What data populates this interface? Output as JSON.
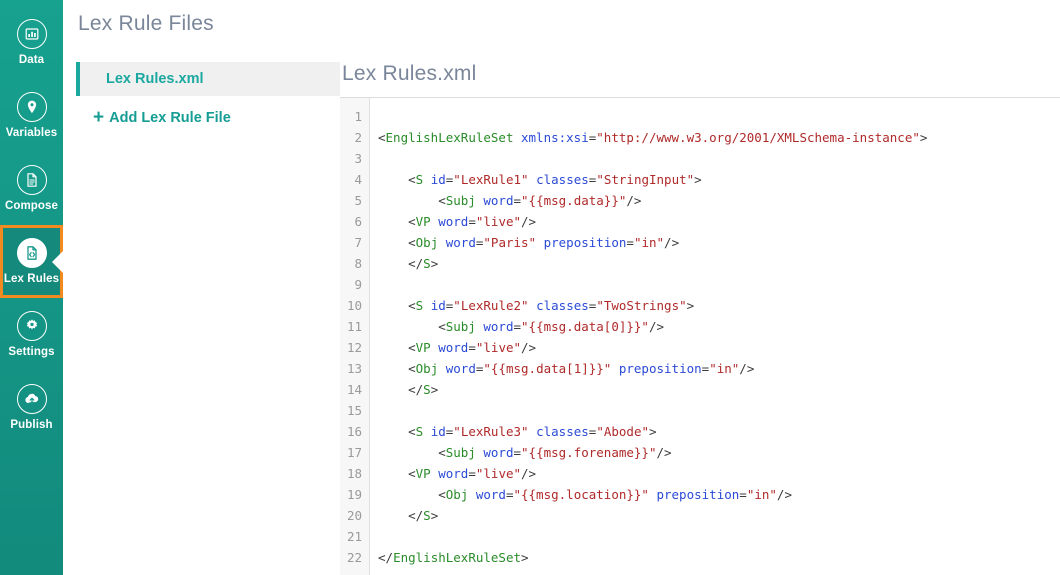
{
  "sidebar": {
    "items": [
      {
        "label": "Data",
        "icon": "chart-bar-icon",
        "active": false
      },
      {
        "label": "Variables",
        "icon": "map-pin-icon",
        "active": false
      },
      {
        "label": "Compose",
        "icon": "document-icon",
        "active": false
      },
      {
        "label": "Lex Rules",
        "icon": "code-file-icon",
        "active": true
      },
      {
        "label": "Settings",
        "icon": "gear-icon",
        "active": false
      },
      {
        "label": "Publish",
        "icon": "cloud-upload-icon",
        "active": false
      }
    ],
    "active_highlight_color": "#f28a20",
    "background_color": "#159588"
  },
  "files_panel": {
    "title": "Lex Rule Files",
    "selected_file": "Lex Rules.xml",
    "add_label": "Add Lex Rule File",
    "add_icon": "plus-icon",
    "accent_color": "#1aa89f"
  },
  "editor": {
    "title": "Lex Rules.xml",
    "line_numbers": [
      1,
      2,
      3,
      4,
      5,
      6,
      7,
      8,
      9,
      10,
      11,
      12,
      13,
      14,
      15,
      16,
      17,
      18,
      19,
      20,
      21,
      22
    ],
    "lines": [
      {
        "n": 1,
        "tokens": []
      },
      {
        "n": 2,
        "tokens": [
          {
            "t": "punc",
            "v": "<"
          },
          {
            "t": "tag",
            "v": "EnglishLexRuleSet"
          },
          {
            "t": "punc",
            "v": " "
          },
          {
            "t": "attr",
            "v": "xmlns:xsi"
          },
          {
            "t": "punc",
            "v": "="
          },
          {
            "t": "str",
            "v": "\"http://www.w3.org/2001/XMLSchema-instance\""
          },
          {
            "t": "punc",
            "v": ">"
          }
        ]
      },
      {
        "n": 3,
        "tokens": []
      },
      {
        "n": 4,
        "tokens": [
          {
            "t": "punc",
            "v": "    <"
          },
          {
            "t": "tag",
            "v": "S"
          },
          {
            "t": "punc",
            "v": " "
          },
          {
            "t": "attr",
            "v": "id"
          },
          {
            "t": "punc",
            "v": "="
          },
          {
            "t": "str",
            "v": "\"LexRule1\""
          },
          {
            "t": "punc",
            "v": " "
          },
          {
            "t": "attr",
            "v": "classes"
          },
          {
            "t": "punc",
            "v": "="
          },
          {
            "t": "str",
            "v": "\"StringInput\""
          },
          {
            "t": "punc",
            "v": ">"
          }
        ]
      },
      {
        "n": 5,
        "tokens": [
          {
            "t": "punc",
            "v": "        <"
          },
          {
            "t": "tag",
            "v": "Subj"
          },
          {
            "t": "punc",
            "v": " "
          },
          {
            "t": "attr",
            "v": "word"
          },
          {
            "t": "punc",
            "v": "="
          },
          {
            "t": "str",
            "v": "\"{{msg.data}}\""
          },
          {
            "t": "punc",
            "v": "/>"
          }
        ]
      },
      {
        "n": 6,
        "tokens": [
          {
            "t": "punc",
            "v": "    <"
          },
          {
            "t": "tag",
            "v": "VP"
          },
          {
            "t": "punc",
            "v": " "
          },
          {
            "t": "attr",
            "v": "word"
          },
          {
            "t": "punc",
            "v": "="
          },
          {
            "t": "str",
            "v": "\"live\""
          },
          {
            "t": "punc",
            "v": "/>"
          }
        ]
      },
      {
        "n": 7,
        "tokens": [
          {
            "t": "punc",
            "v": "    <"
          },
          {
            "t": "tag",
            "v": "Obj"
          },
          {
            "t": "punc",
            "v": " "
          },
          {
            "t": "attr",
            "v": "word"
          },
          {
            "t": "punc",
            "v": "="
          },
          {
            "t": "str",
            "v": "\"Paris\""
          },
          {
            "t": "punc",
            "v": " "
          },
          {
            "t": "attr",
            "v": "preposition"
          },
          {
            "t": "punc",
            "v": "="
          },
          {
            "t": "str",
            "v": "\"in\""
          },
          {
            "t": "punc",
            "v": "/>"
          }
        ]
      },
      {
        "n": 8,
        "tokens": [
          {
            "t": "punc",
            "v": "    </"
          },
          {
            "t": "tag",
            "v": "S"
          },
          {
            "t": "punc",
            "v": ">"
          }
        ]
      },
      {
        "n": 9,
        "tokens": []
      },
      {
        "n": 10,
        "tokens": [
          {
            "t": "punc",
            "v": "    <"
          },
          {
            "t": "tag",
            "v": "S"
          },
          {
            "t": "punc",
            "v": " "
          },
          {
            "t": "attr",
            "v": "id"
          },
          {
            "t": "punc",
            "v": "="
          },
          {
            "t": "str",
            "v": "\"LexRule2\""
          },
          {
            "t": "punc",
            "v": " "
          },
          {
            "t": "attr",
            "v": "classes"
          },
          {
            "t": "punc",
            "v": "="
          },
          {
            "t": "str",
            "v": "\"TwoStrings\""
          },
          {
            "t": "punc",
            "v": ">"
          }
        ]
      },
      {
        "n": 11,
        "tokens": [
          {
            "t": "punc",
            "v": "        <"
          },
          {
            "t": "tag",
            "v": "Subj"
          },
          {
            "t": "punc",
            "v": " "
          },
          {
            "t": "attr",
            "v": "word"
          },
          {
            "t": "punc",
            "v": "="
          },
          {
            "t": "str",
            "v": "\"{{msg.data[0]}}\""
          },
          {
            "t": "punc",
            "v": "/>"
          }
        ]
      },
      {
        "n": 12,
        "tokens": [
          {
            "t": "punc",
            "v": "    <"
          },
          {
            "t": "tag",
            "v": "VP"
          },
          {
            "t": "punc",
            "v": " "
          },
          {
            "t": "attr",
            "v": "word"
          },
          {
            "t": "punc",
            "v": "="
          },
          {
            "t": "str",
            "v": "\"live\""
          },
          {
            "t": "punc",
            "v": "/>"
          }
        ]
      },
      {
        "n": 13,
        "tokens": [
          {
            "t": "punc",
            "v": "    <"
          },
          {
            "t": "tag",
            "v": "Obj"
          },
          {
            "t": "punc",
            "v": " "
          },
          {
            "t": "attr",
            "v": "word"
          },
          {
            "t": "punc",
            "v": "="
          },
          {
            "t": "str",
            "v": "\"{{msg.data[1]}}\""
          },
          {
            "t": "punc",
            "v": " "
          },
          {
            "t": "attr",
            "v": "preposition"
          },
          {
            "t": "punc",
            "v": "="
          },
          {
            "t": "str",
            "v": "\"in\""
          },
          {
            "t": "punc",
            "v": "/>"
          }
        ]
      },
      {
        "n": 14,
        "tokens": [
          {
            "t": "punc",
            "v": "    </"
          },
          {
            "t": "tag",
            "v": "S"
          },
          {
            "t": "punc",
            "v": ">"
          }
        ]
      },
      {
        "n": 15,
        "tokens": []
      },
      {
        "n": 16,
        "tokens": [
          {
            "t": "punc",
            "v": "    <"
          },
          {
            "t": "tag",
            "v": "S"
          },
          {
            "t": "punc",
            "v": " "
          },
          {
            "t": "attr",
            "v": "id"
          },
          {
            "t": "punc",
            "v": "="
          },
          {
            "t": "str",
            "v": "\"LexRule3\""
          },
          {
            "t": "punc",
            "v": " "
          },
          {
            "t": "attr",
            "v": "classes"
          },
          {
            "t": "punc",
            "v": "="
          },
          {
            "t": "str",
            "v": "\"Abode\""
          },
          {
            "t": "punc",
            "v": ">"
          }
        ]
      },
      {
        "n": 17,
        "tokens": [
          {
            "t": "punc",
            "v": "        <"
          },
          {
            "t": "tag",
            "v": "Subj"
          },
          {
            "t": "punc",
            "v": " "
          },
          {
            "t": "attr",
            "v": "word"
          },
          {
            "t": "punc",
            "v": "="
          },
          {
            "t": "str",
            "v": "\"{{msg.forename}}\""
          },
          {
            "t": "punc",
            "v": "/>"
          }
        ]
      },
      {
        "n": 18,
        "tokens": [
          {
            "t": "punc",
            "v": "    <"
          },
          {
            "t": "tag",
            "v": "VP"
          },
          {
            "t": "punc",
            "v": " "
          },
          {
            "t": "attr",
            "v": "word"
          },
          {
            "t": "punc",
            "v": "="
          },
          {
            "t": "str",
            "v": "\"live\""
          },
          {
            "t": "punc",
            "v": "/>"
          }
        ]
      },
      {
        "n": 19,
        "tokens": [
          {
            "t": "punc",
            "v": "        <"
          },
          {
            "t": "tag",
            "v": "Obj"
          },
          {
            "t": "punc",
            "v": " "
          },
          {
            "t": "attr",
            "v": "word"
          },
          {
            "t": "punc",
            "v": "="
          },
          {
            "t": "str",
            "v": "\"{{msg.location}}\""
          },
          {
            "t": "punc",
            "v": " "
          },
          {
            "t": "attr",
            "v": "preposition"
          },
          {
            "t": "punc",
            "v": "="
          },
          {
            "t": "str",
            "v": "\"in\""
          },
          {
            "t": "punc",
            "v": "/>"
          }
        ]
      },
      {
        "n": 20,
        "tokens": [
          {
            "t": "punc",
            "v": "    </"
          },
          {
            "t": "tag",
            "v": "S"
          },
          {
            "t": "punc",
            "v": ">"
          }
        ]
      },
      {
        "n": 21,
        "tokens": []
      },
      {
        "n": 22,
        "tokens": [
          {
            "t": "punc",
            "v": "</"
          },
          {
            "t": "tag",
            "v": "EnglishLexRuleSet"
          },
          {
            "t": "punc",
            "v": ">"
          }
        ]
      }
    ],
    "syntax_colors": {
      "tag": "#2a8c2a",
      "attribute": "#2b4ad6",
      "string": "#b02a2a",
      "punctuation": "#3b3b3b",
      "line_number": "#9a9a9a"
    }
  }
}
